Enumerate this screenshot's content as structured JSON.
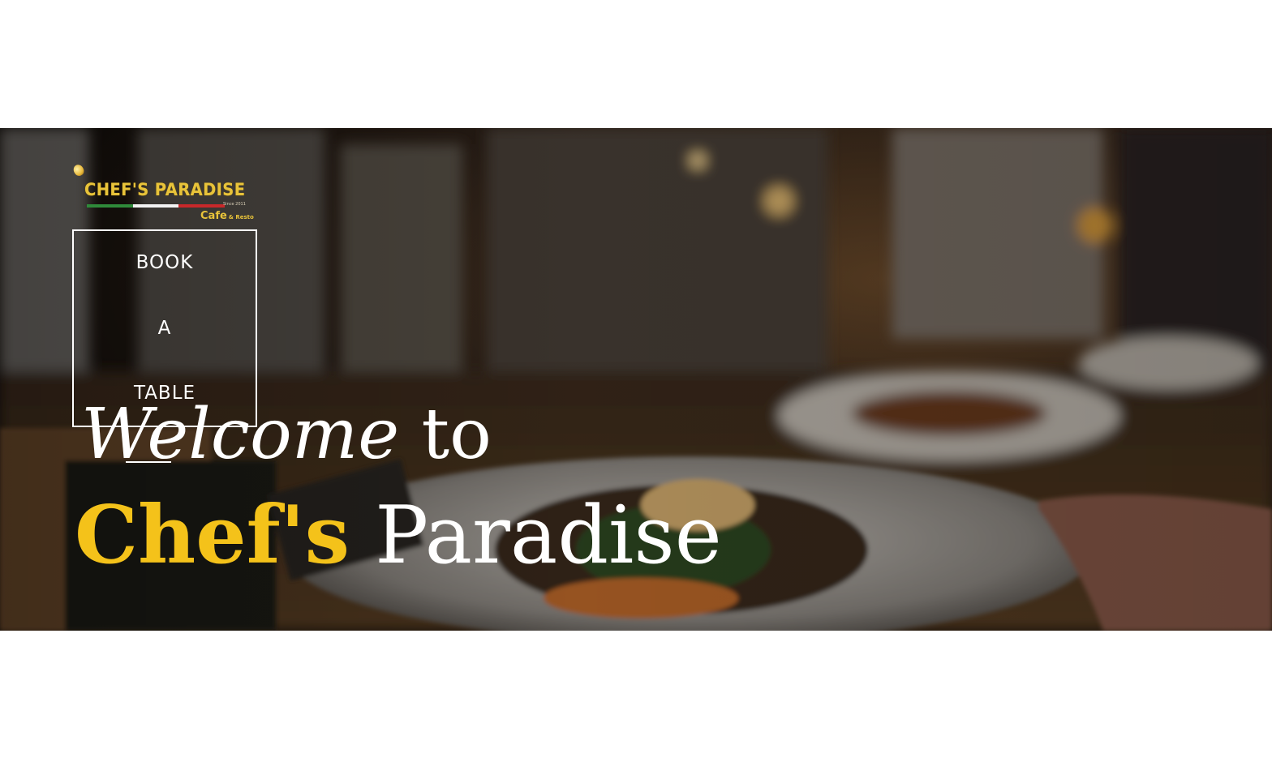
{
  "logo": {
    "name": "CHEF'S PARADISE",
    "since": "Since 2011",
    "sub_main": "Cafe",
    "sub_small": "& Resto"
  },
  "book_button": {
    "line1": "BOOK",
    "line2": "A",
    "line3": "TABLE"
  },
  "hero": {
    "welcome_em": "Welcome",
    "welcome_rest": " to",
    "title_gold": "Chef's",
    "title_rest": " Paradise"
  },
  "colors": {
    "accent_gold": "#f4c21a",
    "text_white": "#ffffff",
    "page_background": "#ffffff"
  }
}
